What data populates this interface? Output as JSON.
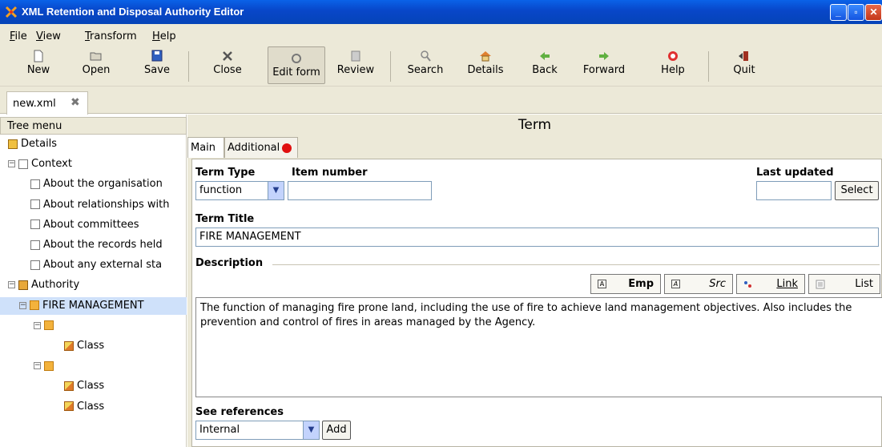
{
  "window": {
    "title": "XML Retention and Disposal Authority Editor",
    "controls": [
      "_",
      "▫",
      "✕"
    ]
  },
  "menu": [
    "File",
    "View",
    "Transform",
    "Help"
  ],
  "toolbar": [
    {
      "label": "New",
      "icon": "new-document-icon"
    },
    {
      "label": "Open",
      "icon": "folder-open-icon"
    },
    {
      "label": "Save",
      "icon": "floppy-disk-icon"
    },
    {
      "label": "Close",
      "icon": "close-x-icon"
    },
    {
      "label": "Edit form",
      "icon": "edit-form-icon",
      "active": true
    },
    {
      "label": "Review",
      "icon": "review-icon"
    },
    {
      "label": "Search",
      "icon": "magnifier-icon"
    },
    {
      "label": "Details",
      "icon": "home-icon"
    },
    {
      "label": "Back",
      "icon": "arrow-left-icon"
    },
    {
      "label": "Forward",
      "icon": "arrow-right-icon"
    },
    {
      "label": "Help",
      "icon": "lifebuoy-icon"
    },
    {
      "label": "Quit",
      "icon": "exit-door-icon"
    }
  ],
  "file_tab": {
    "name": "new.xml",
    "close": "✖"
  },
  "tree": {
    "header": "Tree menu",
    "nodes": [
      {
        "label": "Details",
        "icon": "home",
        "level": 0,
        "expander": ""
      },
      {
        "label": "Context",
        "icon": "doc",
        "level": 0,
        "expander": "−"
      },
      {
        "label": "About the organisation",
        "icon": "doc",
        "level": 1,
        "expander": ""
      },
      {
        "label": "About relationships with",
        "icon": "doc",
        "level": 1,
        "expander": ""
      },
      {
        "label": "About committees",
        "icon": "doc",
        "level": 1,
        "expander": ""
      },
      {
        "label": "About the records held",
        "icon": "doc",
        "level": 1,
        "expander": ""
      },
      {
        "label": "About any external sta",
        "icon": "doc",
        "level": 1,
        "expander": ""
      },
      {
        "label": "Authority",
        "icon": "book",
        "level": 0,
        "expander": "−"
      },
      {
        "label": "FIRE MANAGEMENT",
        "icon": "folder",
        "level": 1,
        "expander": "−",
        "selected": true
      },
      {
        "label": "",
        "icon": "folder",
        "level": 2,
        "expander": "−"
      },
      {
        "label": "Class",
        "icon": "pencil",
        "level": 3,
        "expander": ""
      },
      {
        "label": "",
        "icon": "folder",
        "level": 2,
        "expander": "−"
      },
      {
        "label": "Class",
        "icon": "pencil",
        "level": 3,
        "expander": ""
      },
      {
        "label": "Class",
        "icon": "pencil",
        "level": 3,
        "expander": ""
      }
    ]
  },
  "form": {
    "title": "Term",
    "tabs": [
      {
        "label": "Main",
        "active": true
      },
      {
        "label": "Additional",
        "alert": true
      }
    ],
    "term_type": {
      "label": "Term Type",
      "value": "function"
    },
    "item_number": {
      "label": "Item number",
      "value": ""
    },
    "last_updated": {
      "label": "Last updated",
      "value": "",
      "button": "Select"
    },
    "term_title": {
      "label": "Term Title",
      "value": "FIRE MANAGEMENT"
    },
    "description": {
      "label": "Description",
      "format_buttons": [
        {
          "label": "Emp",
          "icon": "A"
        },
        {
          "label": "Src",
          "icon": "A"
        },
        {
          "label": "Link",
          "icon": "link"
        },
        {
          "label": "List",
          "icon": "list"
        }
      ],
      "text": "The function of managing fire prone land, including the use of fire to achieve land management objectives. Also includes the prevention and control of fires in areas managed by the Agency."
    },
    "see_references": {
      "label": "See references",
      "value": "Internal",
      "button": "Add"
    }
  }
}
